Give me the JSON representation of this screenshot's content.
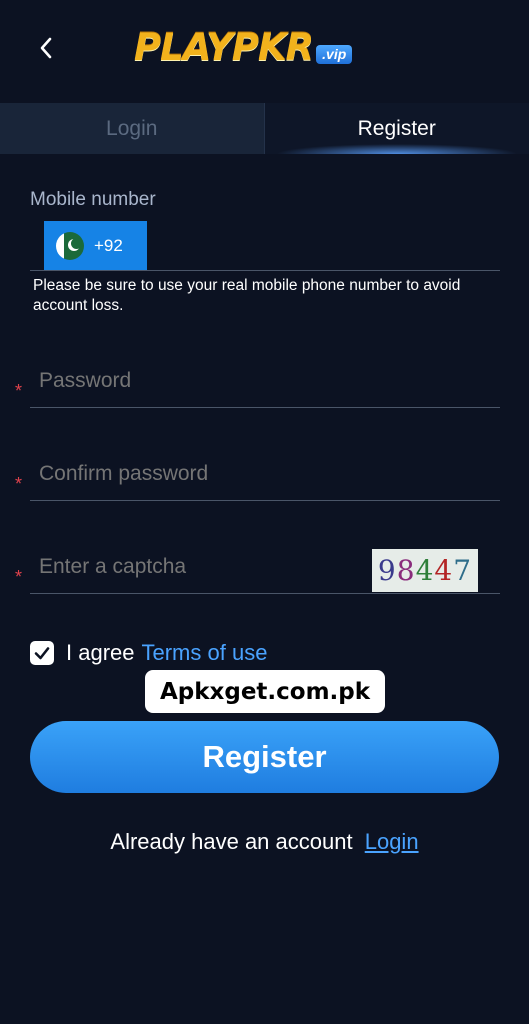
{
  "header": {
    "back_icon": "chevron-left-icon",
    "logo_text": "PLAYPKR",
    "logo_badge": ".vip"
  },
  "tabs": [
    {
      "label": "Login",
      "active": false
    },
    {
      "label": "Register",
      "active": true
    }
  ],
  "mobile": {
    "label": "Mobile number",
    "country_flag": "pakistan-flag-icon",
    "dial_code": "+92",
    "value": "",
    "hint": "Please be sure to use your real mobile phone number to avoid account loss."
  },
  "password": {
    "placeholder": "Password",
    "required_mark": "*"
  },
  "confirm_password": {
    "placeholder": "Confirm password",
    "required_mark": "*"
  },
  "captcha": {
    "placeholder": "Enter a captcha",
    "required_mark": "*",
    "image_digits": [
      "9",
      "8",
      "4",
      "4",
      "7"
    ]
  },
  "agree": {
    "checked": true,
    "text": "I agree",
    "link": "Terms of use"
  },
  "watermark": "Apkxget.com.pk",
  "register_button": "Register",
  "footer": {
    "text": "Already have an account",
    "link": "Login"
  },
  "colors": {
    "background": "#0c1222",
    "accent": "#1f7de0",
    "link": "#4aa3ff",
    "required": "#e0424c"
  }
}
